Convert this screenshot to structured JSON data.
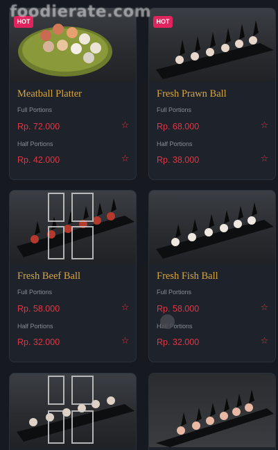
{
  "watermark": "foodierate.com",
  "badge_label": "HOT",
  "star_icon": "star-outline-icon",
  "colors": {
    "accent": "#e03545",
    "badge": "#e0245e",
    "title": "#d6a646",
    "card": "#1e232b",
    "page": "#161a20"
  },
  "products": [
    {
      "name": "Meatball Platter",
      "hot": true,
      "full_label": "Full Portions",
      "full_price": "Rp. 72.000",
      "half_label": "Half Portions",
      "half_price": "Rp. 42.000",
      "image": "meatball-platter-photo"
    },
    {
      "name": "Fresh Prawn Ball",
      "hot": true,
      "full_label": "Full Portions",
      "full_price": "Rp. 68.000",
      "half_label": "Half Portions",
      "half_price": "Rp. 38.000",
      "image": "prawn-ball-photo"
    },
    {
      "name": "Fresh Beef Ball",
      "hot": false,
      "full_label": "Full Portions",
      "full_price": "Rp. 58.000",
      "half_label": "Half Portions",
      "half_price": "Rp. 32.000",
      "image": "beef-ball-photo"
    },
    {
      "name": "Fresh Fish Ball",
      "hot": false,
      "full_label": "Full Portions",
      "full_price": "Rp. 58.000",
      "half_label": "Half Portions",
      "half_price": "Rp. 32.000",
      "image": "fish-ball-photo"
    },
    {
      "name": "",
      "hot": false,
      "image": "balls-on-spoons-photo"
    },
    {
      "name": "",
      "hot": false,
      "image": "balls-on-spoons-photo"
    }
  ]
}
